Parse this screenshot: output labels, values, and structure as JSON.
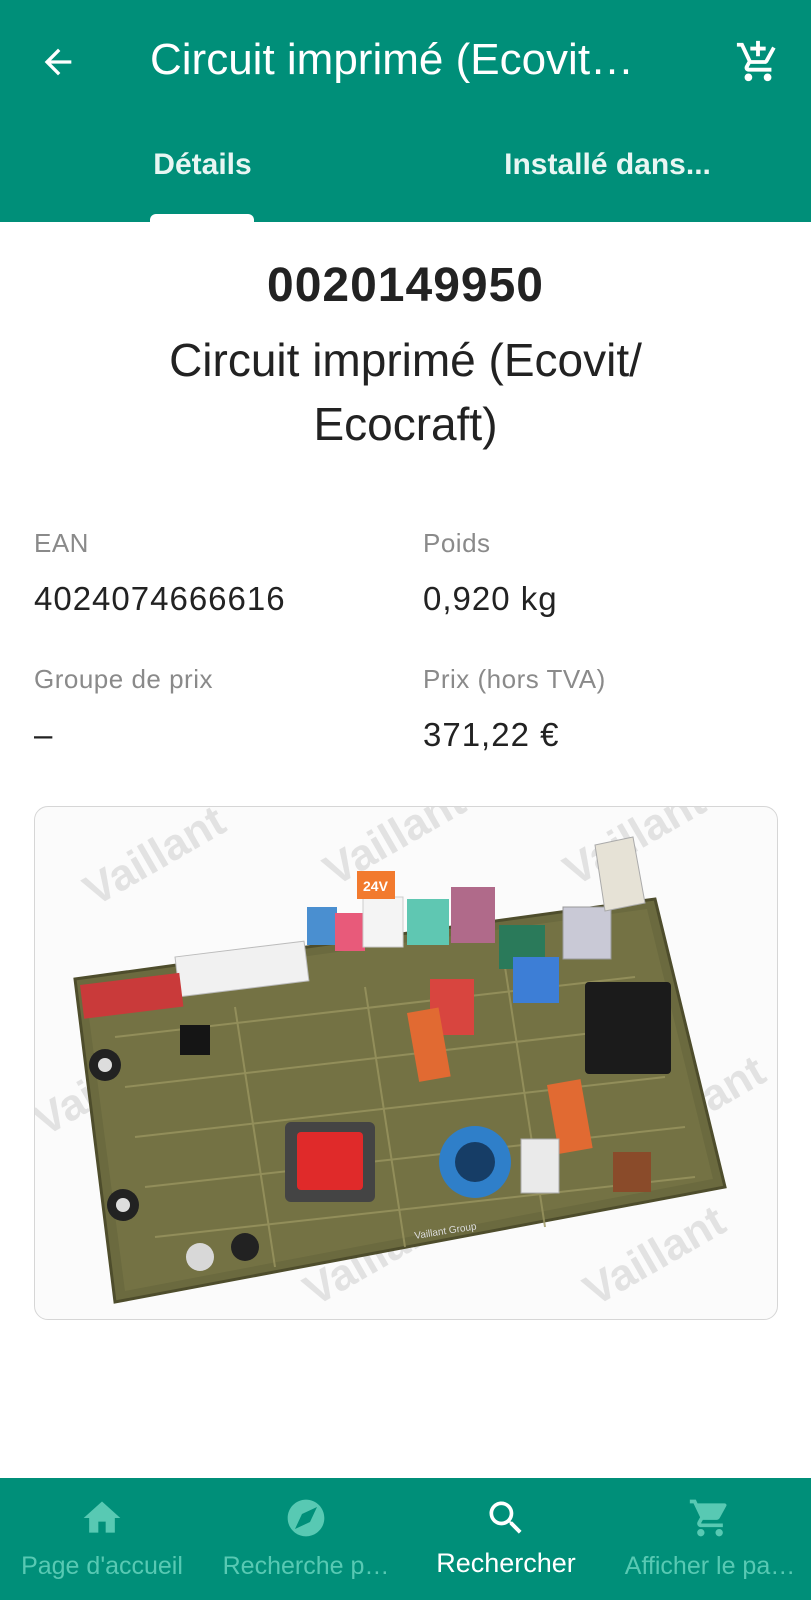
{
  "header": {
    "title": "Circuit imprimé (Ecovit…",
    "back_icon": "arrow-left-icon",
    "cart_icon": "cart-add-icon",
    "background": "#008f79"
  },
  "tabs": [
    {
      "label": "Détails",
      "active": true
    },
    {
      "label": "Installé dans...",
      "active": false
    }
  ],
  "product": {
    "number": "0020149950",
    "name": "Circuit imprimé (Ecovit/ Ecocraft)"
  },
  "info": {
    "ean_label": "EAN",
    "ean_value": "4024074666616",
    "weight_label": "Poids",
    "weight_value": "0,920 kg",
    "price_group_label": "Groupe de prix",
    "price_group_value": "–",
    "price_label": "Prix (hors TVA)",
    "price_value": "371,22 €"
  },
  "image": {
    "watermark": "Vaillant",
    "board_label_1": "24V",
    "board_label_2": "Vaillant Group"
  },
  "bottom_nav": [
    {
      "label": "Page d'accueil",
      "icon": "home-icon",
      "active": false
    },
    {
      "label": "Recherche p…",
      "icon": "compass-icon",
      "active": false
    },
    {
      "label": "Rechercher",
      "icon": "search-icon",
      "active": true
    },
    {
      "label": "Afficher le pa…",
      "icon": "cart-icon",
      "active": false
    }
  ]
}
